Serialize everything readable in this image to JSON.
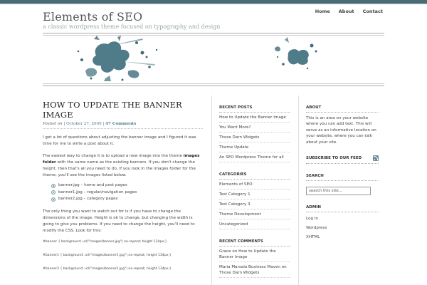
{
  "site": {
    "title": "Elements of SEO",
    "tagline": "a classic wordpress theme focused on typography and design"
  },
  "nav": {
    "items": [
      "Home",
      "About",
      "Contact"
    ]
  },
  "colors": {
    "accent": "#4a6b74",
    "splash": "#3d6d7c",
    "link": "#4a7a8c"
  },
  "post": {
    "title": "HOW TO UPDATE THE BANNER IMAGE",
    "meta_prefix": "Posted on | ",
    "date": "October 27, 2009",
    "meta_sep": " | ",
    "comments": "47 Comments",
    "p1": "I get a lot of questions about adjusting the banner image and I figured it was time for me to write a post about it.",
    "p2_start": "The easiest way to change it is to upload a new image into the theme ",
    "p2_bold": "images folder",
    "p2_end": " with the same name as the existing banners. If you don't change the height, then that's all you need to do. If you look in the images folder for the theme, you'll see the images listed below.",
    "list": [
      "banner.jpg – home and post pages",
      "banner1.jpg – regular/navigation pages",
      "banner2.jpg – category pages"
    ],
    "p3": "The only thing you want to watch out for is if you have to change the dimensions of the image. Height is ok to change, but changing the width is going to give you problems. If you need to change the height, you'll need to modify the CSS. Look for this:",
    "code": [
      "#banner { background: url(\"images/banner.jpg\") no-repeat; height 134px;}",
      "#banner1 { background: url(\"images/banner1.jpg\") no-repeat; height 134px;}",
      "#banner2 { background: url(\"images/banner2.jpg\") no-repeat; height 134px;}"
    ]
  },
  "sidebar1": {
    "recent_posts": {
      "title": "RECENT POSTS",
      "items": [
        "How to Update the Banner Image",
        "You Want More?",
        "Those Darn Widgets",
        "Theme Update",
        "An SEO Wordpress Theme for all"
      ]
    },
    "categories": {
      "title": "CATEGORIES",
      "items": [
        "Elements of SEO",
        "Test Category 1",
        "Test Category 3",
        "Theme Development",
        "Uncategorized"
      ]
    },
    "recent_comments": {
      "title": "RECENT COMMENTS",
      "items": [
        "Grace on How to Update the Banner Image",
        "Maria Marsala Business Maven on Those Darn Widgets"
      ]
    }
  },
  "sidebar2": {
    "about": {
      "title": "ABOUT",
      "text": "This is an area on your website where you can add text. This will serve as an informative location on your website, where you can talk about your site."
    },
    "subscribe": {
      "title": "SUBSCRIBE TO OUR FEED",
      "icon": "rss-icon"
    },
    "search": {
      "title": "SEARCH",
      "placeholder": "search this site..."
    },
    "admin": {
      "title": "ADMIN",
      "items": [
        "Log in",
        "Wordpress",
        "XHTML"
      ]
    }
  }
}
